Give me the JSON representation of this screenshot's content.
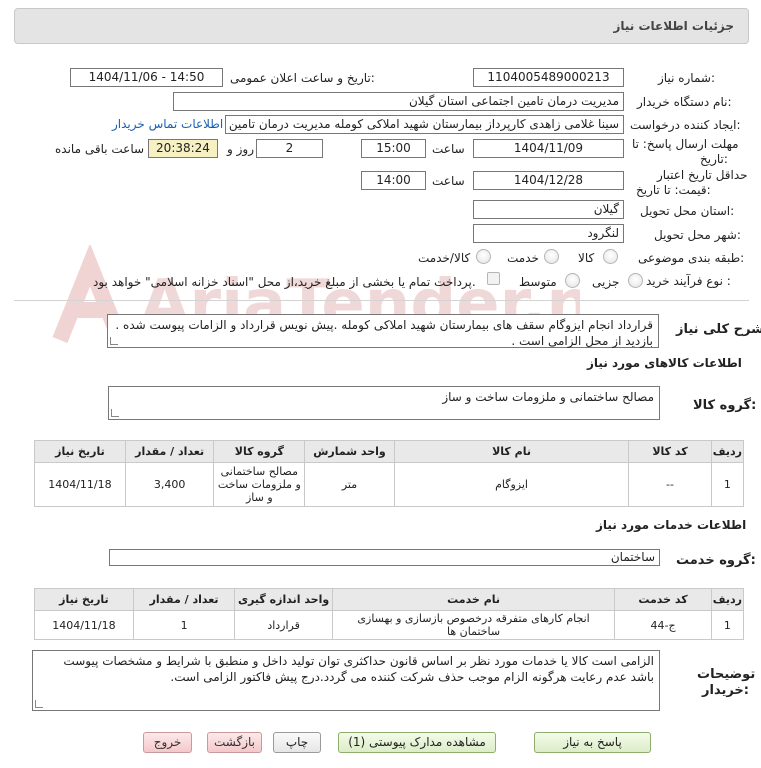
{
  "header": {
    "title": "جزئیات اطلاعات نیاز"
  },
  "fields": {
    "need_number_label": "شماره نیاز:",
    "need_number": "1104005489000213",
    "announce_label": "تاریخ و ساعت اعلان عمومی:",
    "announce_value": "1404/11/06 - 14:50",
    "buyer_org_label": "نام دستگاه خریدار:",
    "buyer_org": "مدیریت درمان تامین اجتماعی استان گیلان",
    "requester_label": "ایجاد کننده درخواست:",
    "requester": "سینا غلامی زاهدی کارپرداز بیمارستان شهید املاکی کومله مدیریت درمان تامین",
    "contact_link": "اطلاعات تماس خریدار",
    "deadline_label_1": "مهلت ارسال پاسخ: تا",
    "deadline_label_2": "تاریخ:",
    "deadline_date": "1404/11/09",
    "time_label": "ساعت",
    "deadline_time": "15:00",
    "days_value": "2",
    "days_label": "روز و",
    "remaining_time": "20:38:24",
    "remaining_label": "ساعت باقی مانده",
    "validity_label_1": "حداقل تاریخ اعتبار",
    "validity_label_2": "قیمت: تا تاریخ:",
    "validity_date": "1404/12/28",
    "validity_time": "14:00",
    "province_label": "استان محل تحویل:",
    "province": "گیلان",
    "city_label": "شهر محل تحویل:",
    "city": "لنگرود",
    "category_label": "طبقه بندی موضوعی:",
    "category_options": [
      "کالا/خدمت",
      "خدمت",
      "کالا"
    ],
    "process_label": "نوع فرآیند خرید :",
    "process_options": [
      "جزیی",
      "متوسط"
    ],
    "process_note": "پرداخت تمام یا بخشی از مبلغ خرید،از محل \"اسناد خزانه اسلامی\" خواهد بود."
  },
  "description": {
    "label": "شرح کلی نیاز:",
    "text": "قرارداد انجام ایزوگام سقف های بیمارستان شهید املاکی کومله .پیش نویس قرارداد و الزامات پیوست شده . بازدید از محل الزامی است ."
  },
  "goods": {
    "section_title": "اطلاعات کالاهای مورد نیاز",
    "group_label": "گروه کالا:",
    "group_value": "مصالح ساختمانی و ملزومات ساخت و ساز",
    "columns": [
      "ردیف",
      "کد کالا",
      "نام کالا",
      "واحد شمارش",
      "گروه کالا",
      "تعداد / مقدار",
      "تاریخ نیاز"
    ],
    "rows": [
      [
        "1",
        "--",
        "ایزوگام",
        "متر",
        "مصالح ساختمانی و ملزومات ساخت و ساز",
        "3,400",
        "1404/11/18"
      ]
    ]
  },
  "services": {
    "section_title": "اطلاعات خدمات مورد نیاز",
    "group_label": "گروه خدمت:",
    "group_value": "ساختمان",
    "columns": [
      "ردیف",
      "کد خدمت",
      "نام خدمت",
      "واحد اندازه گیری",
      "تعداد / مقدار",
      "تاریخ نیاز"
    ],
    "rows": [
      [
        "1",
        "ج-44",
        "انجام کارهای متفرقه درخصوص بازسازی و بهسازی ساختمان ها",
        "قرارداد",
        "1",
        "1404/11/18"
      ]
    ]
  },
  "buyer_notes": {
    "label_1": "توضیحات",
    "label_2": "خریدار:",
    "text": "الزامی است کالا یا خدمات مورد نظر بر اساس قانون حداکثری توان تولید داخل و منطبق با شرایط و مشخصات پیوست باشد عدم رعایت هرگونه الزام موجب حذف شرکت کننده می گردد.درج پیش فاکتور الزامی است."
  },
  "buttons": {
    "reply": "پاسخ به نیاز",
    "attachments": "مشاهده مدارک پیوستی (1)",
    "print": "چاپ",
    "back": "بازگشت",
    "exit": "خروج"
  },
  "watermark": {
    "text": "AriaTender.neT"
  },
  "colors": {
    "link": "#1a5fb4",
    "header_bg": "#e4e4e4",
    "remaining_bg": "#f7f0c2",
    "watermark": "#f0d3d3"
  }
}
